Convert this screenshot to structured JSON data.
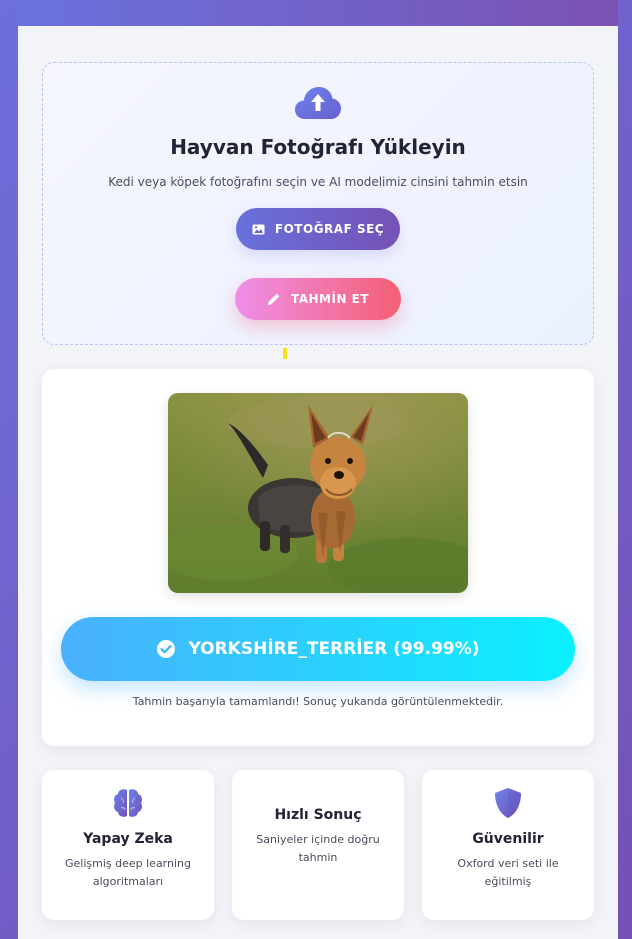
{
  "upload": {
    "title": "Hayvan Fotoğrafı Yükleyin",
    "subtitle": "Kedi veya köpek fotoğrafını seçin ve AI modelimiz cinsini tahmin etsin",
    "select_button": "FOTOĞRAF SEÇ",
    "predict_button": "TAHMİN ET"
  },
  "result": {
    "prediction": "YORKSHİRE_TERRİER (99.99%)",
    "note": "Tahmin başarıyla tamamlandı! Sonuç yukanda görüntülenmektedir."
  },
  "features": [
    {
      "icon": "brain-icon",
      "title": "Yapay Zeka",
      "desc": "Gelişmiş deep learning algoritmaları"
    },
    {
      "icon": "bolt-icon",
      "title": "Hızlı Sonuç",
      "desc": "Saniyeler içinde doğru tahmin"
    },
    {
      "icon": "shield-icon",
      "title": "Güvenilir",
      "desc": "Oxford veri seti ile eğitilmiş"
    }
  ],
  "colors": {
    "primary": "#6a72de",
    "secondary": "#7551b6",
    "predict_start": "#ee8fe8",
    "predict_end": "#f45f73",
    "result_start": "#4ab0fd",
    "result_end": "#0bf0fe"
  }
}
